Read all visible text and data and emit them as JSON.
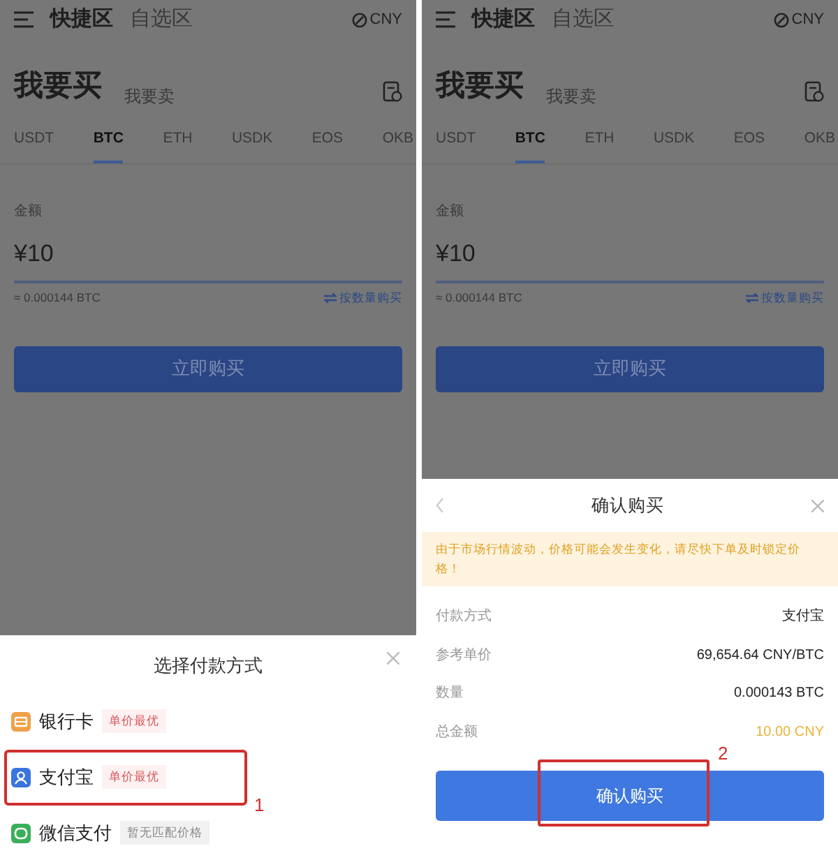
{
  "screens": [
    {
      "header_tabs": [
        {
          "label": "快捷区",
          "selected": true
        },
        {
          "label": "自选区",
          "selected": false
        }
      ],
      "currency": "CNY",
      "mode_tabs": [
        {
          "label": "我要买",
          "selected": true
        },
        {
          "label": "我要卖",
          "selected": false
        }
      ],
      "coin_tabs": [
        {
          "label": "USDT",
          "selected": false
        },
        {
          "label": "BTC",
          "selected": true
        },
        {
          "label": "ETH",
          "selected": false
        },
        {
          "label": "USDK",
          "selected": false
        },
        {
          "label": "EOS",
          "selected": false
        },
        {
          "label": "OKB",
          "selected": false
        }
      ],
      "amount_label": "金额",
      "amount_value": "¥10",
      "estimate": "≈ 0.000144 BTC",
      "switch_link": "按数量购买",
      "buy_button": "立即购买",
      "payment_sheet": {
        "title": "选择付款方式",
        "annotation": "1",
        "methods": [
          {
            "kind": "bank",
            "name": "银行卡",
            "tag": "单价最优",
            "disabled": false,
            "highlighted": false
          },
          {
            "kind": "alipay",
            "name": "支付宝",
            "tag": "单价最优",
            "disabled": false,
            "highlighted": true
          },
          {
            "kind": "wechat",
            "name": "微信支付",
            "tag": "暂无匹配价格",
            "disabled": true,
            "highlighted": false
          }
        ]
      }
    },
    {
      "header_tabs": [
        {
          "label": "快捷区",
          "selected": true
        },
        {
          "label": "自选区",
          "selected": false
        }
      ],
      "currency": "CNY",
      "mode_tabs": [
        {
          "label": "我要买",
          "selected": true
        },
        {
          "label": "我要卖",
          "selected": false
        }
      ],
      "coin_tabs": [
        {
          "label": "USDT",
          "selected": false
        },
        {
          "label": "BTC",
          "selected": true
        },
        {
          "label": "ETH",
          "selected": false
        },
        {
          "label": "USDK",
          "selected": false
        },
        {
          "label": "EOS",
          "selected": false
        },
        {
          "label": "OKB",
          "selected": false
        }
      ],
      "amount_label": "金额",
      "amount_value": "¥10",
      "estimate": "≈ 0.000144 BTC",
      "switch_link": "按数量购买",
      "buy_button": "立即购买",
      "confirm_dialog": {
        "title": "确认购买",
        "notice": "由于市场行情波动，价格可能会发生变化，请尽快下单及时锁定价格！",
        "annotation": "2",
        "confirm_button": "确认购买",
        "rows": [
          {
            "label": "付款方式",
            "value": "支付宝",
            "emphasized": false
          },
          {
            "label": "参考单价",
            "value": "69,654.64 CNY/BTC",
            "emphasized": false
          },
          {
            "label": "数量",
            "value": "0.000143 BTC",
            "emphasized": false
          },
          {
            "label": "总金额",
            "value": "10.00 CNY",
            "emphasized": true
          }
        ]
      }
    }
  ]
}
